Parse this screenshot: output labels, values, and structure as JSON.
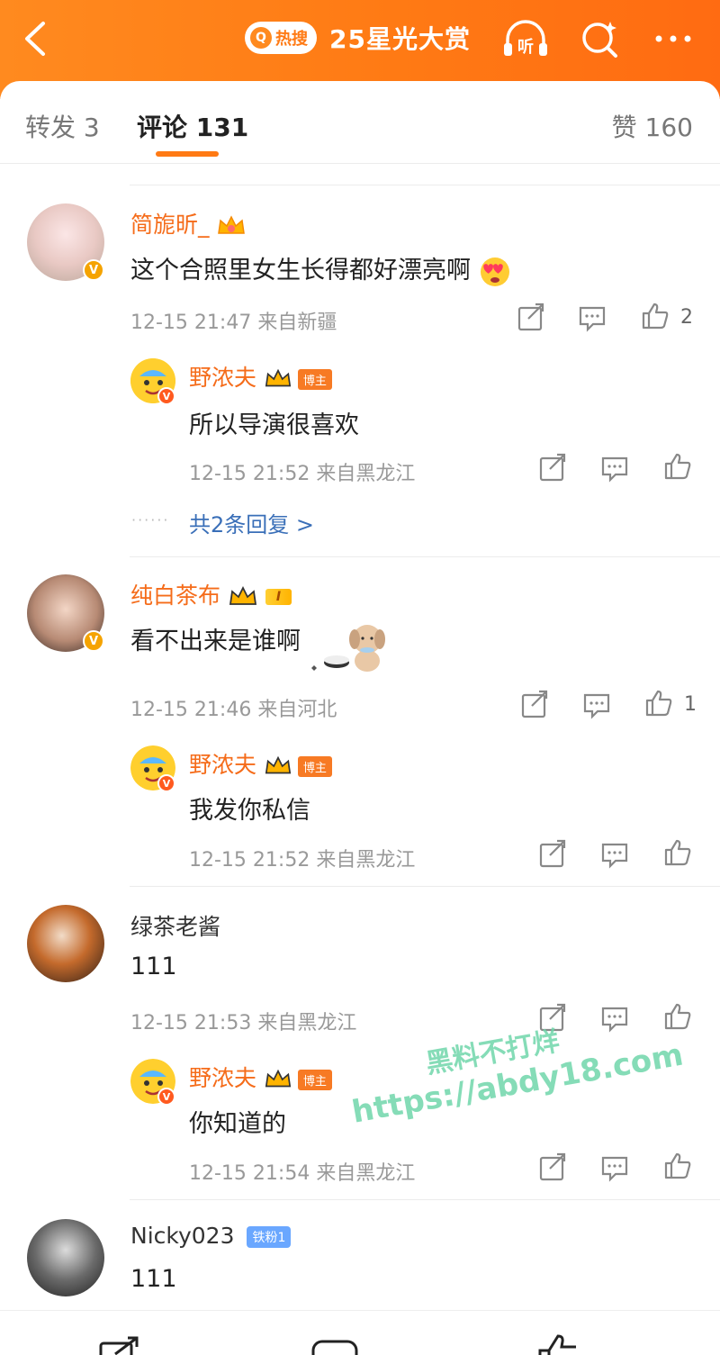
{
  "header": {
    "hot_label": "热搜",
    "topic": "25星光大赏",
    "listen_label": "听",
    "colors": {
      "bar": "#ff7a14",
      "accent": "#f56c1a",
      "link": "#3a6fb8"
    }
  },
  "tabs": {
    "forward": "转发 3",
    "comments": "评论 131",
    "likes": "赞 160"
  },
  "comments": [
    {
      "user": "简旎昕_",
      "text": "这个合照里女生长得都好漂亮啊",
      "meta": "12-15 21:47 来自新疆",
      "likes": "2",
      "reply": {
        "user": "野浓夫",
        "tag": "博主",
        "text": "所以导演很喜欢",
        "meta": "12-15 21:52 来自黑龙江"
      },
      "more": "共2条回复 >"
    },
    {
      "user": "纯白茶布",
      "level": "I",
      "text": "看不出来是谁啊",
      "meta": "12-15 21:46 来自河北",
      "likes": "1",
      "reply": {
        "user": "野浓夫",
        "tag": "博主",
        "text": "我发你私信",
        "meta": "12-15 21:52 来自黑龙江"
      }
    },
    {
      "user": "绿茶老酱",
      "text": "111",
      "meta": "12-15 21:53 来自黑龙江",
      "reply": {
        "user": "野浓夫",
        "tag": "博主",
        "text": "你知道的",
        "meta": "12-15 21:54 来自黑龙江"
      }
    },
    {
      "user": "Nicky023",
      "tag": "铁粉1",
      "text": "111"
    }
  ],
  "watermark": {
    "line1": "黑料不打烊",
    "line2": "https://abdy18.com"
  }
}
